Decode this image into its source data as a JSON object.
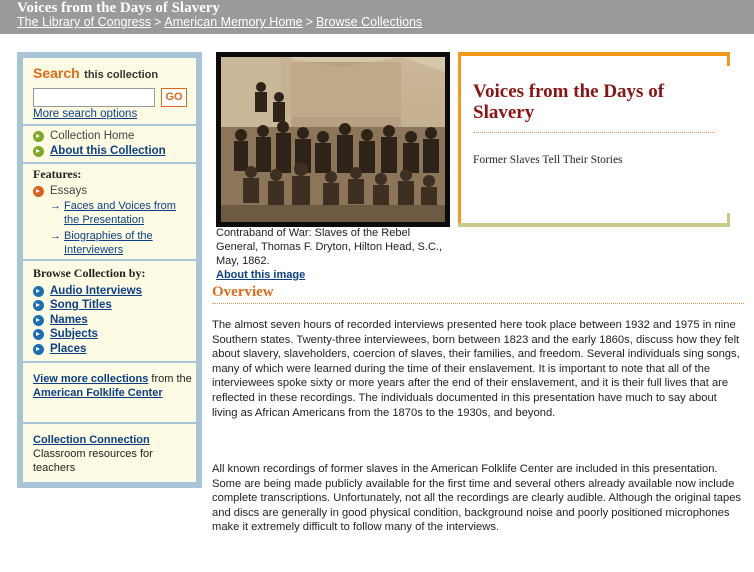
{
  "header": {
    "title": "Voices from the Days of Slavery",
    "breadcrumb": [
      "The Library of Congress",
      "American Memory Home",
      "Browse Collections"
    ],
    "separator": ">"
  },
  "sidebar": {
    "search_label": "Search",
    "search_sub": "this collection",
    "search_placeholder": "",
    "go_label": "GO",
    "more_search": "More search options",
    "collection_home": "Collection Home",
    "about_collection": "About this Collection",
    "features_heading": "Features:",
    "essays": "Essays",
    "essay_links": [
      "Faces and Voices from the Presentation",
      "Biographies of the Interviewers"
    ],
    "browse_heading": "Browse Collection by:",
    "browse_links": [
      "Audio Interviews",
      "Song Titles",
      "Names",
      "Subjects",
      "Places"
    ],
    "more_collections_link": "View more collections",
    "more_collections_mid": "from the",
    "more_collections_org": "American Folklife Center",
    "connection_link": "Collection Connection",
    "connection_text": "Classroom resources for teachers",
    "colors": {
      "frame": "#a8c4d6",
      "panel": "#fdfbe3",
      "link": "#0b3f86",
      "accent": "#e06a1a"
    }
  },
  "image": {
    "caption": "Contraband of War: Slaves of the Rebel General, Thomas F. Dryton, Hilton Head, S.C., May, 1862.",
    "about_link": "About this image"
  },
  "title_box": {
    "title": "Voices from the Days of Slavery",
    "subtitle": "Former Slaves Tell Their Stories",
    "colors": {
      "title": "#8a1414",
      "top_border": "#f59a18",
      "bottom_border": "#c9c98a"
    }
  },
  "overview": {
    "heading": "Overview",
    "paragraphs": [
      "The almost seven hours of recorded interviews presented here took place between 1932 and 1975 in nine Southern states. Twenty-three interviewees, born between 1823 and the early 1860s, discuss how they felt about slavery, slaveholders, coercion of slaves, their families, and freedom. Several individuals sing songs, many of which were learned during the time of their enslavement. It is important to note that all of the interviewees spoke sixty or more years after the end of their enslavement, and it is their full lives that are reflected in these recordings. The individuals documented in this presentation have much to say about living as African Americans from the 1870s to the 1930s, and beyond.",
      "All known recordings of former slaves in the American Folklife Center are included in this presentation. Some are being made publicly available for the first time and several others already available now include complete transcriptions. Unfortunately, not all the recordings are clearly audible. Although the original tapes and discs are generally in good physical condition, background noise and poorly positioned microphones make it extremely difficult to follow many of the interviews."
    ]
  }
}
